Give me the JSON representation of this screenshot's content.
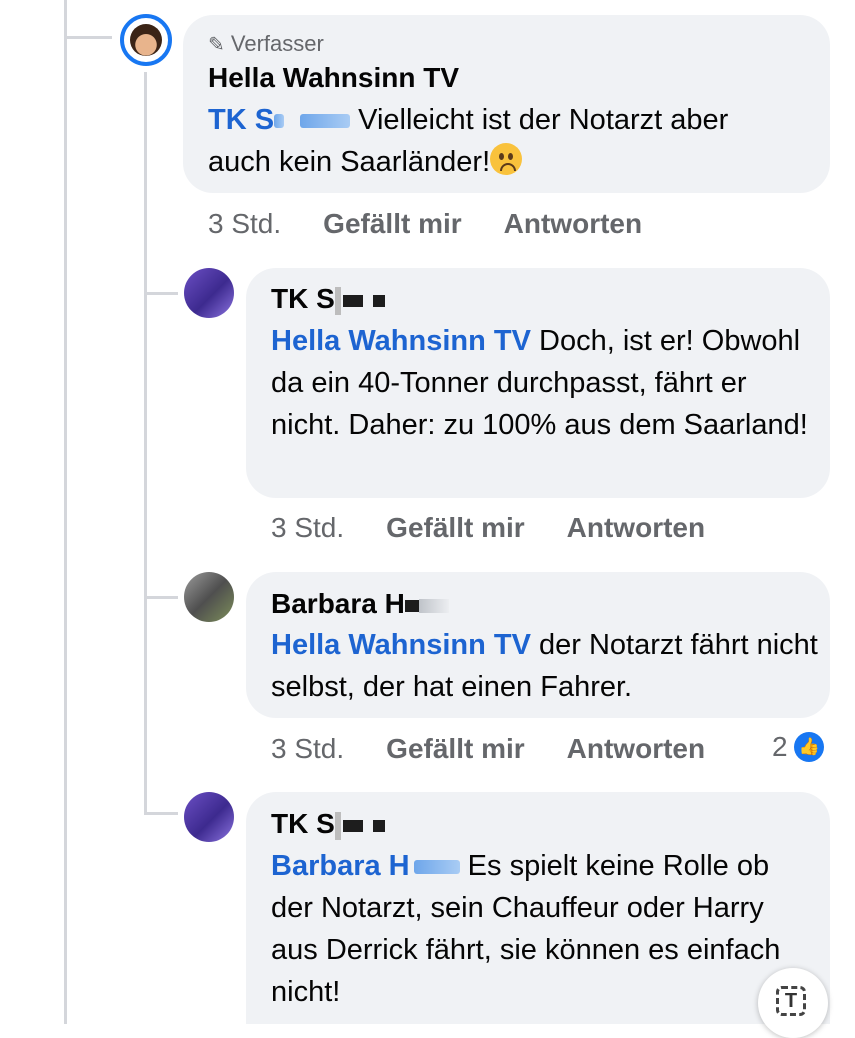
{
  "comments": [
    {
      "badge": "Verfasser",
      "author": "Hella Wahnsinn TV",
      "mention": "TK S",
      "text_line1": "Vielleicht ist der Notarzt aber",
      "text_line2": "auch kein Saarländer!",
      "emoji": "worried-face-icon",
      "time": "3 Std.",
      "like_label": "Gefällt mir",
      "reply_label": "Antworten"
    },
    {
      "author": "TK S",
      "mention": "Hella Wahnsinn TV",
      "text": " Doch, ist er! Obwohl da ein 40-Tonner durchpasst, fährt er nicht. Daher: zu 100% aus dem Saarland!",
      "time": "3 Std.",
      "like_label": "Gefällt mir",
      "reply_label": "Antworten"
    },
    {
      "author": "Barbara H",
      "mention": "Hella Wahnsinn TV",
      "text": " der Notarzt fährt nicht selbst, der hat einen Fahrer.",
      "time": "3 Std.",
      "like_label": "Gefällt mir",
      "reply_label": "Antworten",
      "reaction_count": "2"
    },
    {
      "author": "TK S",
      "mention": "Barbara H",
      "text": " Es spielt keine Rolle ob der Notarzt, sein Chauffeur oder Harry aus Derrick fährt, sie können es einfach nicht!"
    }
  ],
  "colors": {
    "mention": "#1d64d1",
    "bubble": "#f0f2f5",
    "meta": "#65676b",
    "like_blue": "#1877f2"
  }
}
